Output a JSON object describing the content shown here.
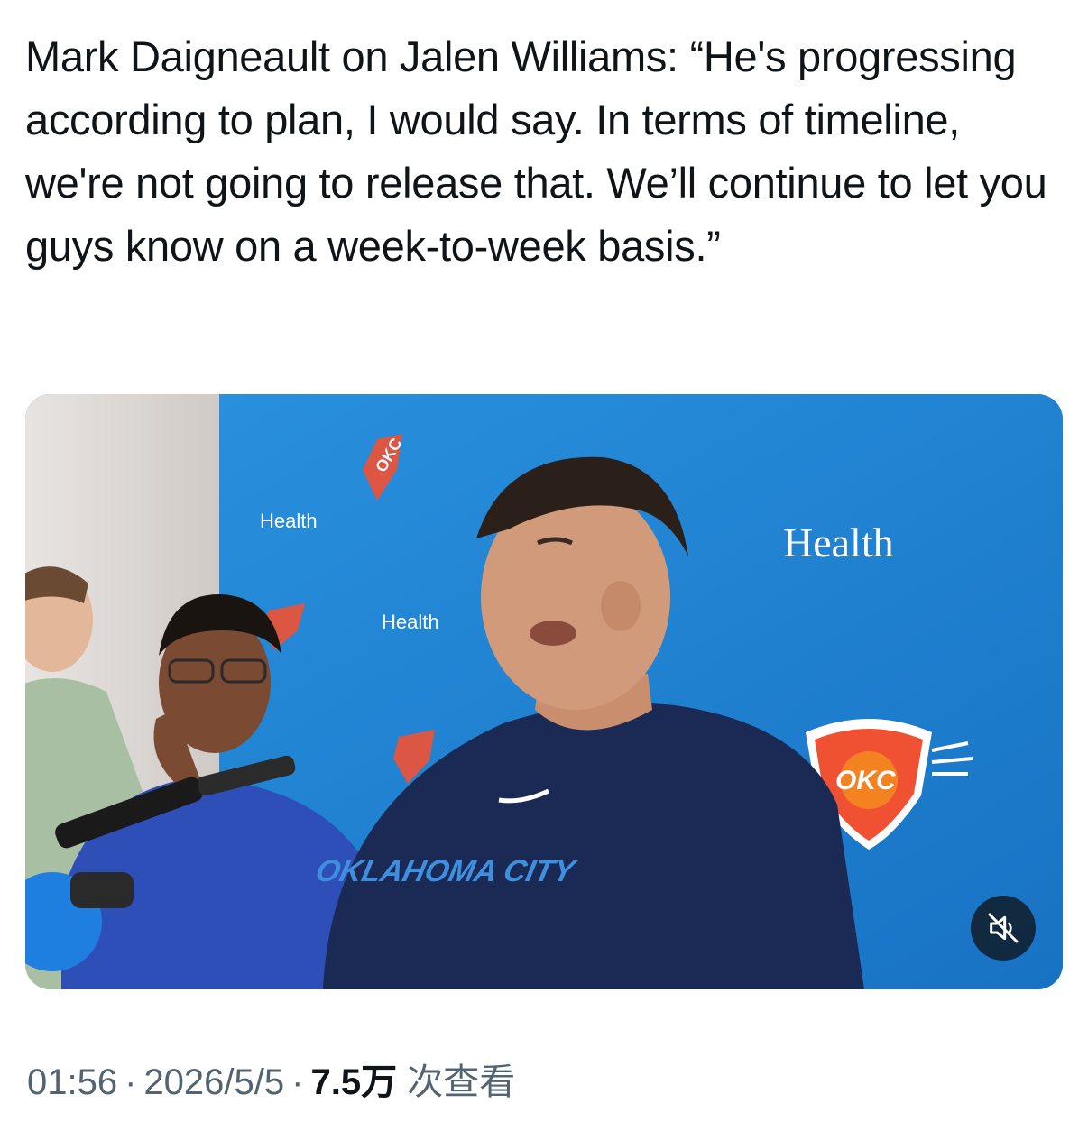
{
  "tweet": {
    "text": "Mark Daigneault on Jalen Williams: “He's progressing according to plan, I would say. In terms of timeline, we're not going to release that. We’ll continue to let you guys know on a week-to-week basis.”"
  },
  "media": {
    "type": "video",
    "muted": true,
    "backdrop_logos": [
      "OKC",
      "OU Health"
    ],
    "sponsor_text": "Health",
    "sponsor_text_big": "Health",
    "team_logo_text": "OKC",
    "shirt_text": "OKLAHOMA CITY",
    "brand_color": "#1e88d8"
  },
  "meta": {
    "time": "01:56",
    "separator": "·",
    "date": "2026/5/5",
    "views_count": "7.5万",
    "views_label": "次查看"
  },
  "icons": {
    "mute": "speaker-muted-icon"
  },
  "colors": {
    "text_primary": "#0f1419",
    "text_secondary": "#536471",
    "accent": "#1d9bf0"
  }
}
